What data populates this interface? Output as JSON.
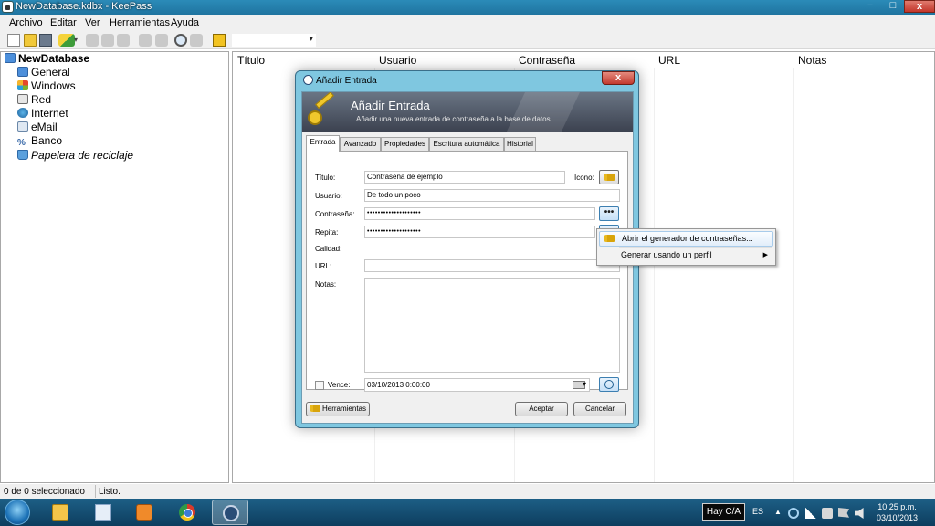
{
  "window": {
    "title": "NewDatabase.kdbx - KeePass",
    "min_glyph": "−",
    "max_glyph": "□",
    "close_glyph": "x"
  },
  "menu": [
    "Archivo",
    "Editar",
    "Ver",
    "Herramientas",
    "Ayuda"
  ],
  "tree": {
    "root": "NewDatabase",
    "groups": [
      "General",
      "Windows",
      "Red",
      "Internet",
      "eMail",
      "Banco",
      "Papelera de reciclaje"
    ],
    "icons": [
      "folder-icon",
      "windows-icon",
      "network-icon",
      "globe-icon",
      "email-icon",
      "percent-icon",
      "recycle-bin-icon"
    ]
  },
  "list": {
    "columns": [
      "Título",
      "Usuario",
      "Contraseña",
      "URL",
      "Notas"
    ]
  },
  "status": {
    "selection": "0 de 0 seleccionado",
    "state": "Listo."
  },
  "dialog": {
    "title": "Añadir Entrada",
    "banner_title": "Añadir Entrada",
    "banner_subtitle": "Añadir una nueva entrada de contraseña a la base de datos.",
    "tabs": [
      "Entrada",
      "Avanzado",
      "Propiedades",
      "Escritura automática",
      "Historial"
    ],
    "active_tab": "Entrada",
    "labels": {
      "title": "Título:",
      "icon": "Icono:",
      "user": "Usuario:",
      "password": "Contraseña:",
      "repeat": "Repita:",
      "quality": "Calidad:",
      "url": "URL:",
      "notes": "Notas:",
      "expires": "Vence:"
    },
    "values": {
      "title": "Contraseña de ejemplo",
      "user": "De todo un poco",
      "password": "••••••••••••••••••••",
      "repeat": "••••••••••••••••••••",
      "url": "",
      "notes": "",
      "expires": "03/10/2013   0:00:00"
    },
    "reveal_button": "•••",
    "buttons": {
      "tools": "Herramientas",
      "ok": "Aceptar",
      "cancel": "Cancelar"
    },
    "close_glyph": "x"
  },
  "context_menu": {
    "items": [
      "Abrir el generador de contraseñas...",
      "Generar usando un perfil"
    ],
    "submenu_arrow": "▶"
  },
  "taskbar": {
    "apps": [
      "explorer",
      "mail",
      "media-player",
      "chrome",
      "keepass"
    ],
    "keyboard_label": "Hay C/A",
    "language": "ES",
    "tray_arrow": "▲",
    "time": "10:25 p.m.",
    "date": "03/10/2013"
  }
}
